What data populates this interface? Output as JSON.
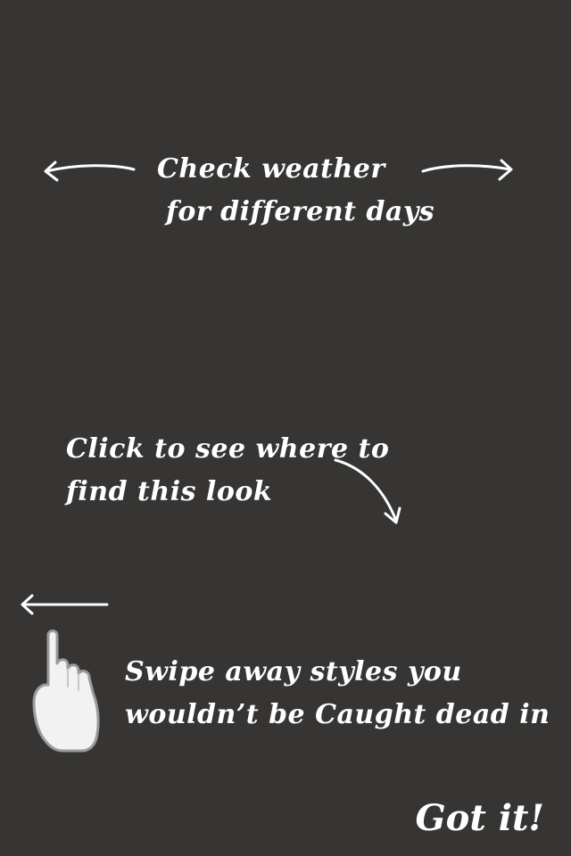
{
  "overlay": {
    "background_color": "#363534",
    "text_color": "#ffffff"
  },
  "weather_hint": {
    "line1": "Check weather",
    "line2": "for different days",
    "icons": [
      "arrow-left-icon",
      "arrow-right-icon"
    ]
  },
  "look_hint": {
    "line1": "Click to see where to",
    "line2": "find this look",
    "icon": "curved-arrow-down-icon"
  },
  "swipe_hint": {
    "line1": "Swipe away styles you",
    "line2": "wouldn’t be Caught dead in",
    "icons": [
      "arrow-left-icon",
      "pointing-hand-icon"
    ]
  },
  "dismiss": {
    "label": "Got it!"
  }
}
